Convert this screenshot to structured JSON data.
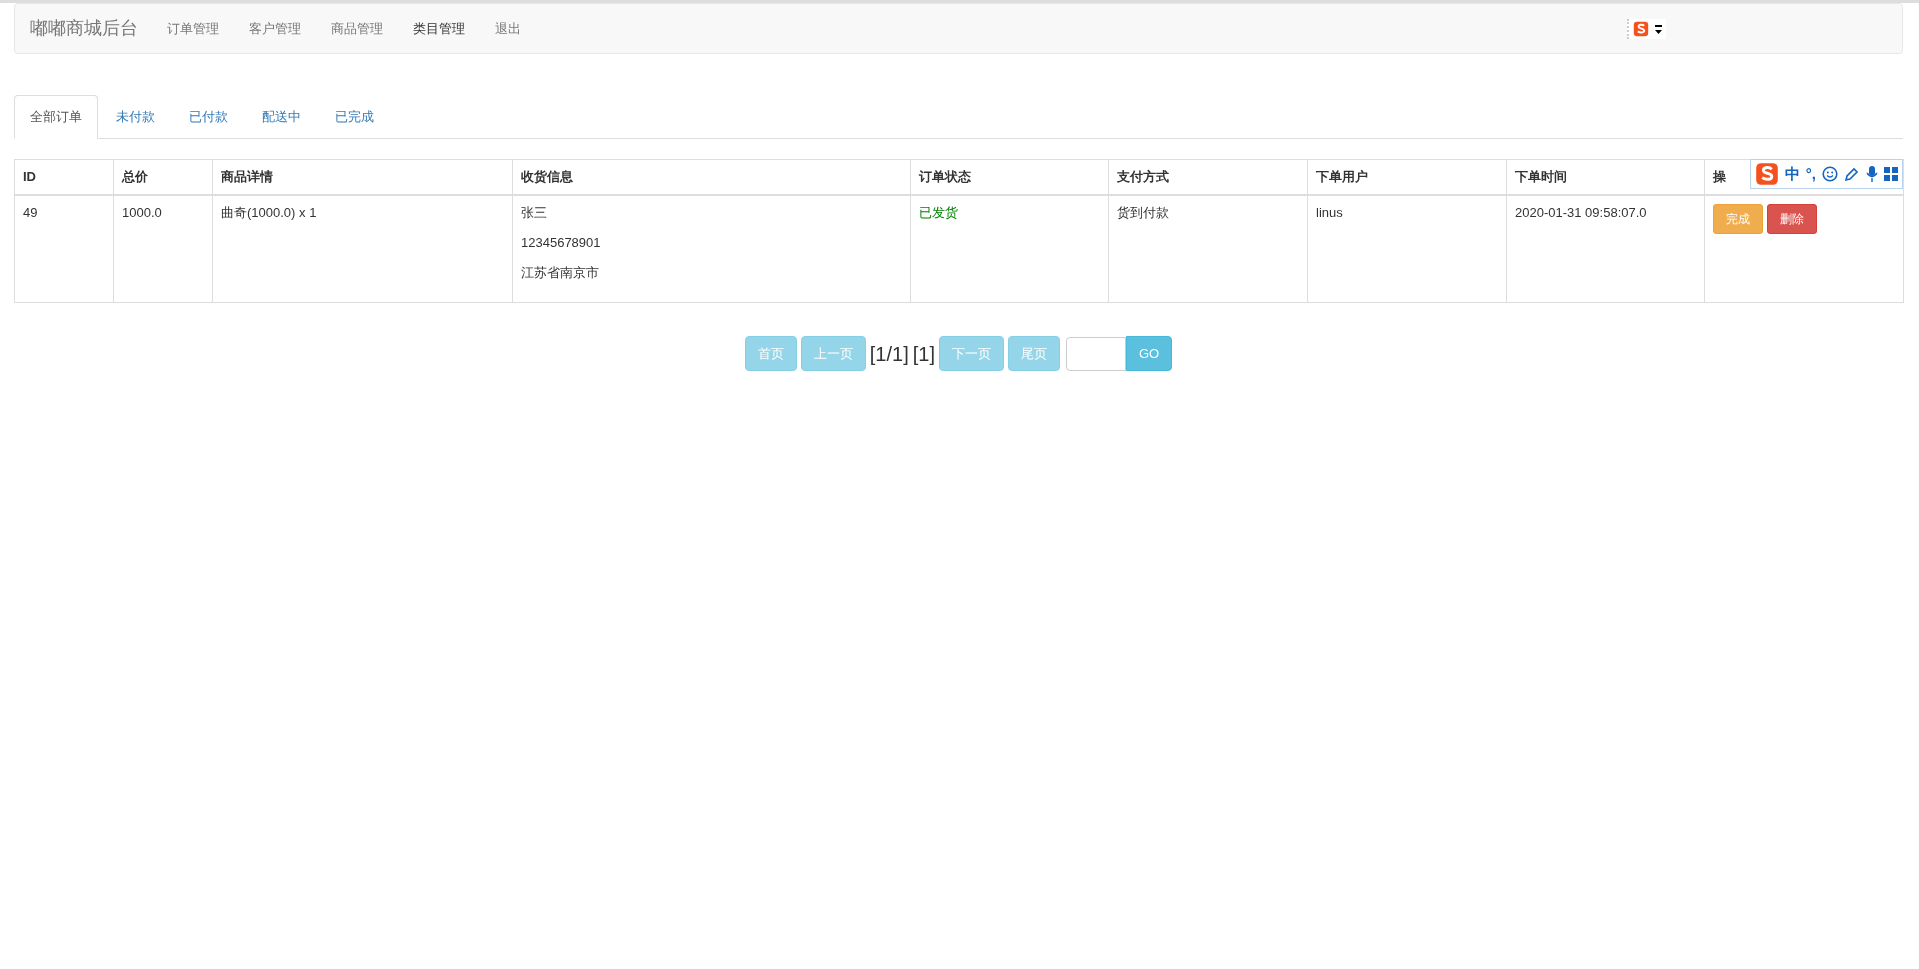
{
  "navbar": {
    "brand": "嘟嘟商城后台",
    "items": [
      {
        "label": "订单管理",
        "selected": false
      },
      {
        "label": "客户管理",
        "selected": false
      },
      {
        "label": "商品管理",
        "selected": false
      },
      {
        "label": "类目管理",
        "selected": true
      },
      {
        "label": "退出",
        "selected": false
      }
    ]
  },
  "tabs": [
    {
      "label": "全部订单",
      "selected": true
    },
    {
      "label": "未付款",
      "selected": false
    },
    {
      "label": "已付款",
      "selected": false
    },
    {
      "label": "配送中",
      "selected": false
    },
    {
      "label": "已完成",
      "selected": false
    }
  ],
  "table": {
    "columns": [
      "ID",
      "总价",
      "商品详情",
      "收货信息",
      "订单状态",
      "支付方式",
      "下单用户",
      "下单时间",
      "操"
    ],
    "rows": [
      {
        "id": "49",
        "total": "1000.0",
        "detail": "曲奇(1000.0) x 1",
        "receiver": [
          "张三",
          "12345678901",
          "江苏省南京市"
        ],
        "status": {
          "text": "已发货",
          "color": "#008000"
        },
        "payment": "货到付款",
        "user": "linus",
        "time": "2020-01-31 09:58:07.0",
        "actions": [
          {
            "label": "完成",
            "kind": "warning"
          },
          {
            "label": "删除",
            "kind": "danger"
          }
        ]
      }
    ]
  },
  "pagination": {
    "before": [
      {
        "label": "首页",
        "disabled": true
      },
      {
        "label": "上一页",
        "disabled": true
      }
    ],
    "info": "[1/1]",
    "pages": "[1]",
    "after": [
      {
        "label": "下一页",
        "disabled": true
      },
      {
        "label": "尾页",
        "disabled": true
      }
    ],
    "go": "GO"
  },
  "ime_toolbar": {
    "mode": "中",
    "punct": "°,"
  }
}
